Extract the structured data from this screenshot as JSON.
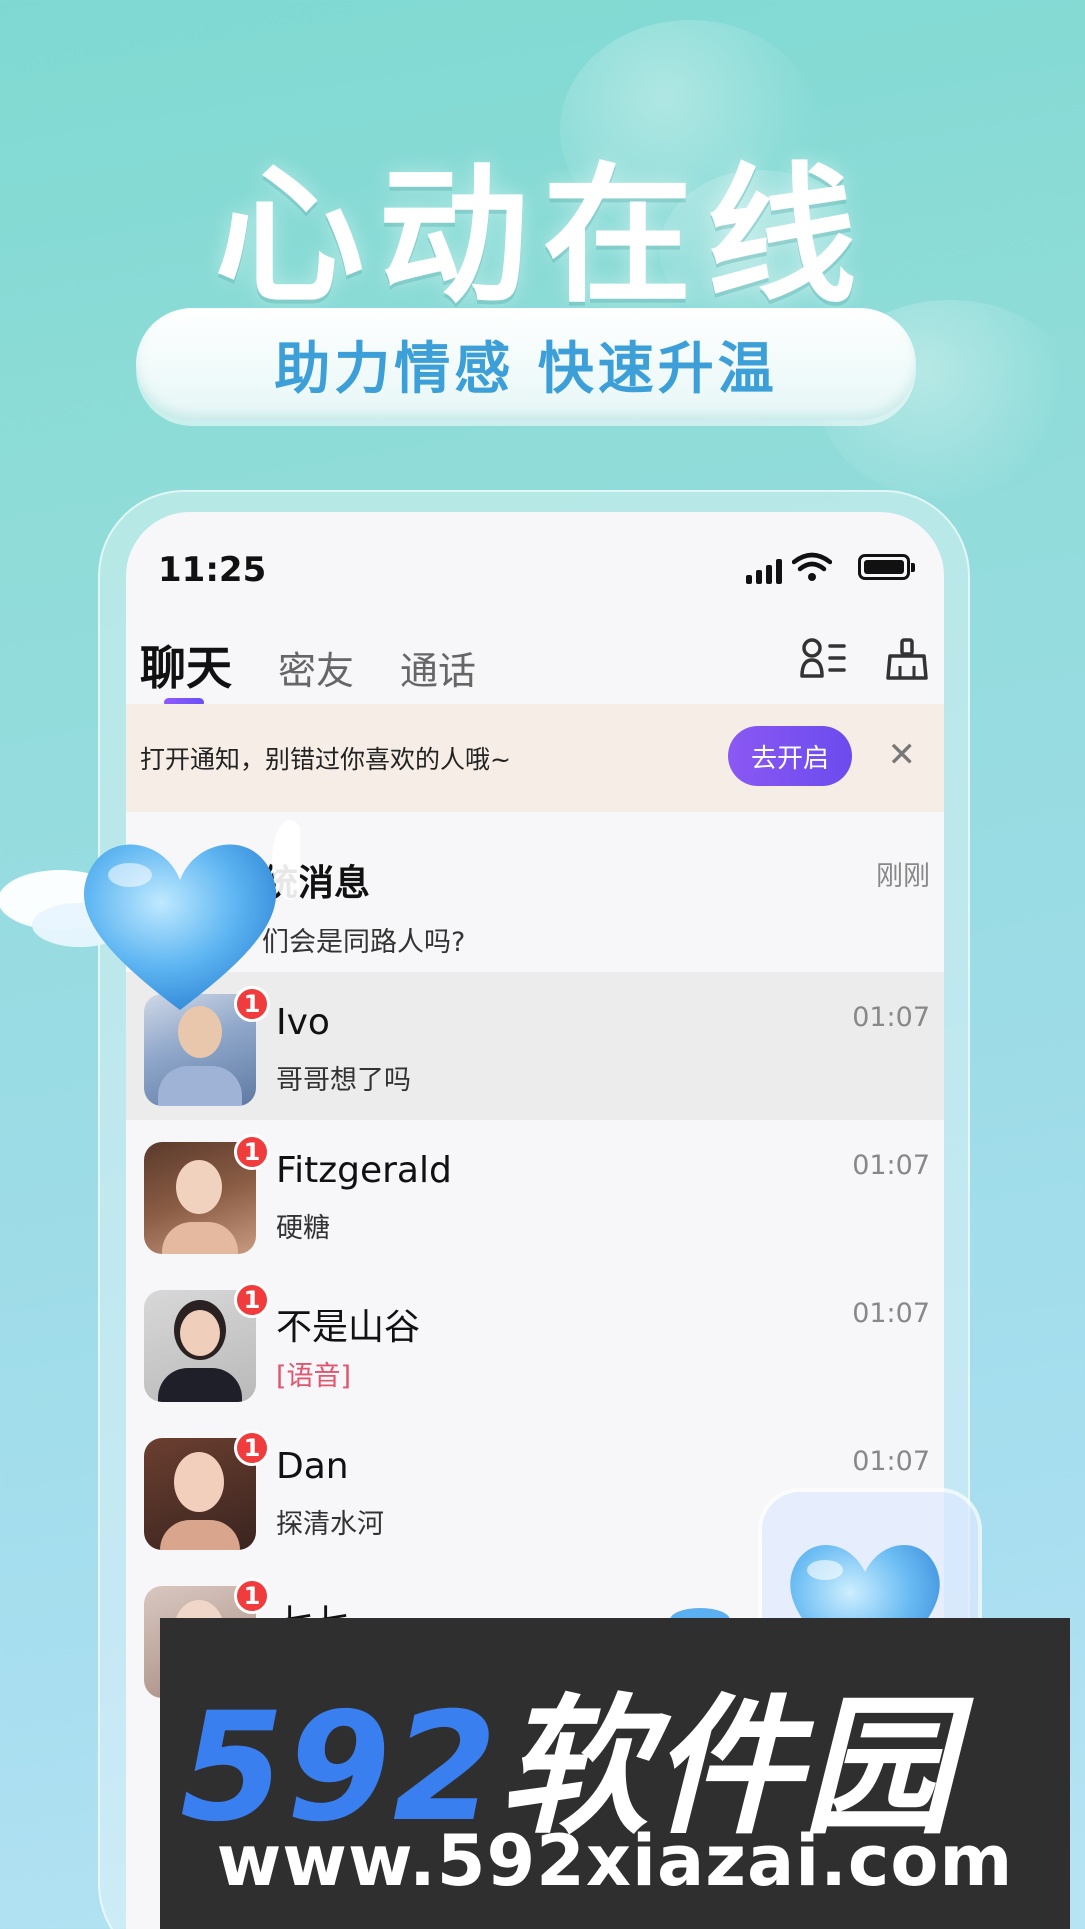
{
  "promo": {
    "headline": "心动在线",
    "slogan": "助力情感  快速升温"
  },
  "status_bar": {
    "time": "11:25"
  },
  "tabs": [
    {
      "label": "聊天",
      "active": true
    },
    {
      "label": "密友",
      "active": false
    },
    {
      "label": "通话",
      "active": false
    }
  ],
  "icons": {
    "contacts": "contacts-icon",
    "clean": "broom-icon",
    "close": "close-icon"
  },
  "notice": {
    "text": "打开通知，别错过你喜欢的人哦~",
    "button": "去开启",
    "close": "✕"
  },
  "system_message": {
    "title": "统消息",
    "preview": "们会是同路人吗?",
    "time": "刚刚"
  },
  "chats": [
    {
      "name": "Ivo",
      "preview": "哥哥想了吗",
      "time": "01:07",
      "unread": "1"
    },
    {
      "name": "Fitzgerald",
      "preview": "硬糖",
      "time": "01:07",
      "unread": "1"
    },
    {
      "name": "不是山谷",
      "preview": "[语音]",
      "time": "01:07",
      "unread": "1"
    },
    {
      "name": "Dan",
      "preview": "探清水河",
      "time": "01:07",
      "unread": "1"
    },
    {
      "name": "七七",
      "preview": "",
      "time": "",
      "unread": "1"
    }
  ],
  "watermark": {
    "logo_number": "592",
    "logo_text": "软件园",
    "url": "www.592xiazai.com"
  },
  "colors": {
    "accent": "#7a52f2",
    "badge": "#f03c3c",
    "voice": "#e0566f",
    "slogan": "#3c9fd8",
    "watermark_blue": "#3a7ff0"
  }
}
